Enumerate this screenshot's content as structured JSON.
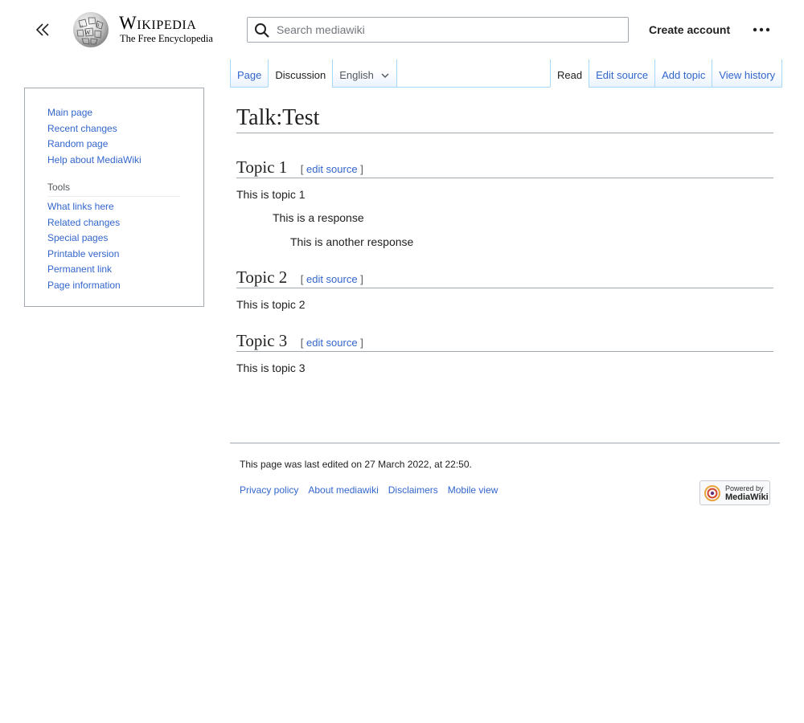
{
  "header": {
    "logo_wordmark": "Wikipedia",
    "logo_tagline": "The Free Encyclopedia",
    "search_placeholder": "Search mediawiki",
    "create_account": "Create account",
    "icons": {
      "collapse": "double-chevron-left-icon",
      "search": "search-icon",
      "more": "ellipsis-icon"
    }
  },
  "sidebar": {
    "nav_items": [
      "Main page",
      "Recent changes",
      "Random page",
      "Help about MediaWiki"
    ],
    "tools_heading": "Tools",
    "tools_items": [
      "What links here",
      "Related changes",
      "Special pages",
      "Printable version",
      "Permanent link",
      "Page information"
    ]
  },
  "tabs": {
    "left": [
      {
        "label": "Page",
        "selected": false
      },
      {
        "label": "Discussion",
        "selected": true
      }
    ],
    "variant": "English",
    "right": [
      {
        "label": "Read",
        "selected": true
      },
      {
        "label": "Edit source",
        "selected": false
      },
      {
        "label": "Add topic",
        "selected": false
      },
      {
        "label": "View history",
        "selected": false
      }
    ]
  },
  "content": {
    "title": "Talk:Test",
    "edit_bracket_open": "[",
    "edit_bracket_close": "]",
    "sections": [
      {
        "heading": "Topic 1",
        "edit_label": "edit source",
        "paragraphs": [
          "This is topic 1",
          "This is a response",
          "This is another response"
        ]
      },
      {
        "heading": "Topic 2",
        "edit_label": "edit source",
        "paragraphs": [
          "This is topic 2"
        ]
      },
      {
        "heading": "Topic 3",
        "edit_label": "edit source",
        "paragraphs": [
          "This is topic 3"
        ]
      }
    ]
  },
  "footer": {
    "last_modified": "This page was last edited on 27 March 2022, at 22:50.",
    "links": [
      "Privacy policy",
      "About mediawiki",
      "Disclaimers",
      "Mobile view"
    ],
    "powered_line1": "Powered by",
    "powered_line2": "MediaWiki"
  },
  "colors": {
    "link": "#3366cc",
    "text": "#202122",
    "border": "#a2a9b1",
    "tab_border": "#a7d7f9"
  }
}
